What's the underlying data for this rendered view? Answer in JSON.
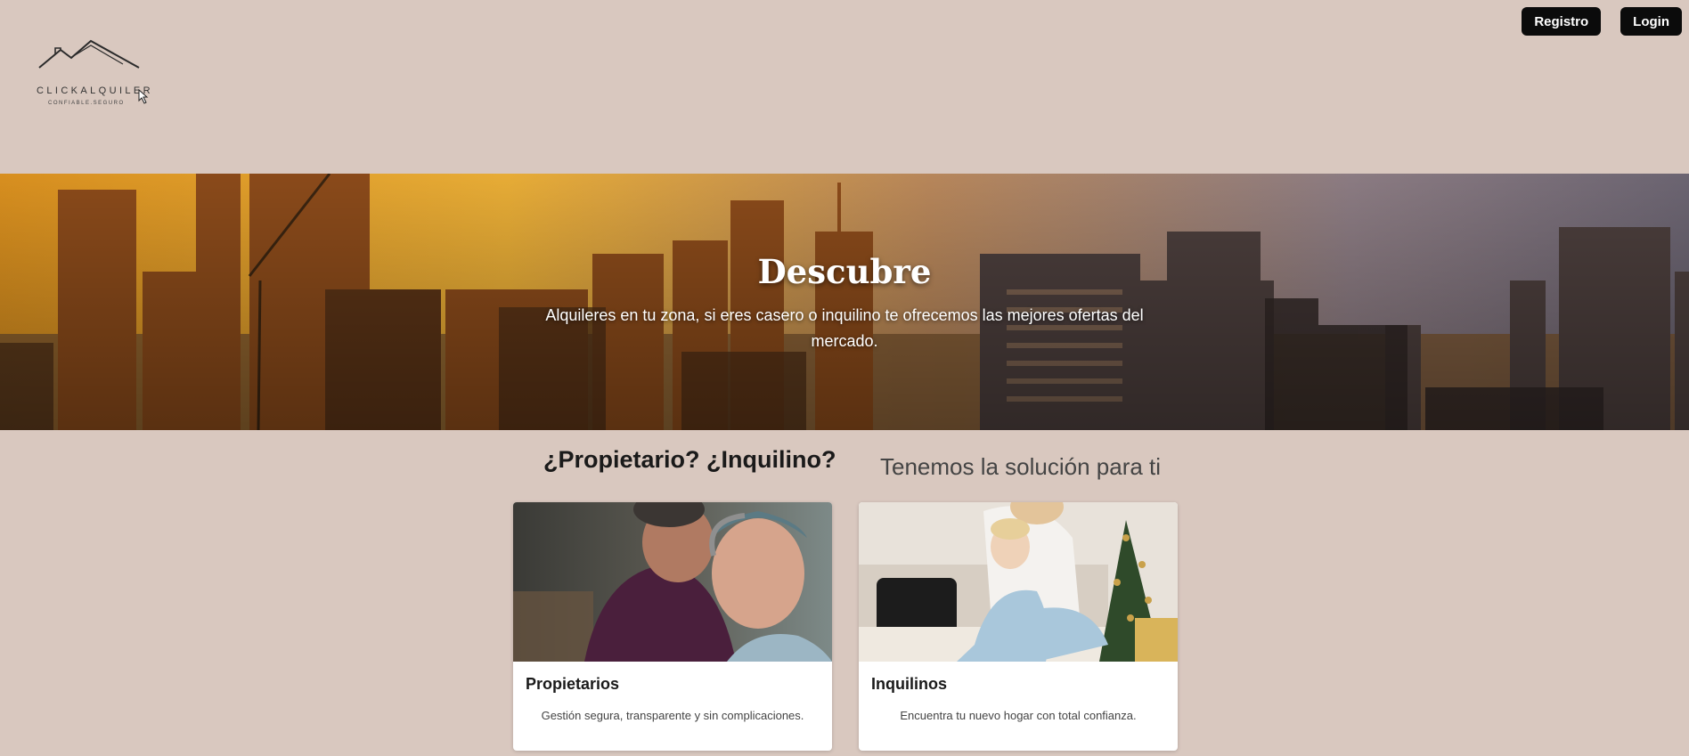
{
  "header": {
    "logo_text": "CLICKALQUILER",
    "logo_tagline": "CONFIABLE.SEGURO",
    "register_label": "Registro",
    "login_label": "Login"
  },
  "hero": {
    "title": "Descubre",
    "subtitle": "Alquileres en tu zona, si eres casero o inquilino te ofrecemos las mejores ofertas del mercado."
  },
  "section": {
    "heading": "¿Propietario? ¿Inquilino?",
    "subheading": "Tenemos la solución para ti"
  },
  "cards": [
    {
      "title": "Propietarios",
      "text": "Gestión segura, transparente y sin complicaciones."
    },
    {
      "title": "Inquilinos",
      "text": "Encuentra tu nuevo hogar con total confianza."
    }
  ],
  "colors": {
    "page_background": "#d9c8bf",
    "button_background": "#0b0b0b",
    "button_text": "#ffffff"
  }
}
